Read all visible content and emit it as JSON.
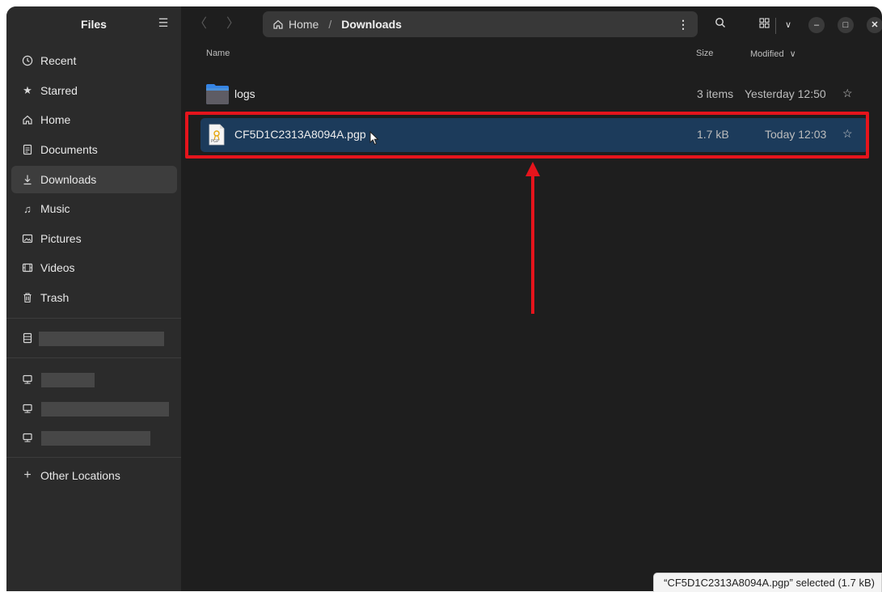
{
  "app": {
    "title": "Files"
  },
  "sidebar": {
    "items": [
      {
        "label": "Recent",
        "icon": "clock-icon"
      },
      {
        "label": "Starred",
        "icon": "star-icon"
      },
      {
        "label": "Home",
        "icon": "home-icon"
      },
      {
        "label": "Documents",
        "icon": "document-icon"
      },
      {
        "label": "Downloads",
        "icon": "download-icon",
        "active": true
      },
      {
        "label": "Music",
        "icon": "music-icon"
      },
      {
        "label": "Pictures",
        "icon": "picture-icon"
      },
      {
        "label": "Videos",
        "icon": "video-icon"
      },
      {
        "label": "Trash",
        "icon": "trash-icon"
      }
    ],
    "other_locations": "Other Locations"
  },
  "path": {
    "home": "Home",
    "separator": "/",
    "current": "Downloads"
  },
  "columns": {
    "name": "Name",
    "size": "Size",
    "modified": "Modified"
  },
  "files": [
    {
      "name": "logs",
      "size": "3 items",
      "modified": "Yesterday 12:50",
      "type": "folder"
    },
    {
      "name": "CF5D1C2313A8094A.pgp",
      "size": "1.7 kB",
      "modified": "Today 12:03",
      "type": "pgp",
      "selected": true
    }
  ],
  "file_icon_label": "PGP",
  "status": {
    "text": "“CF5D1C2313A8094A.pgp” selected  (1.7 kB)"
  },
  "colors": {
    "selection": "#1c3b5b",
    "highlight": "#e5141c",
    "arrow": "#e5141c"
  }
}
